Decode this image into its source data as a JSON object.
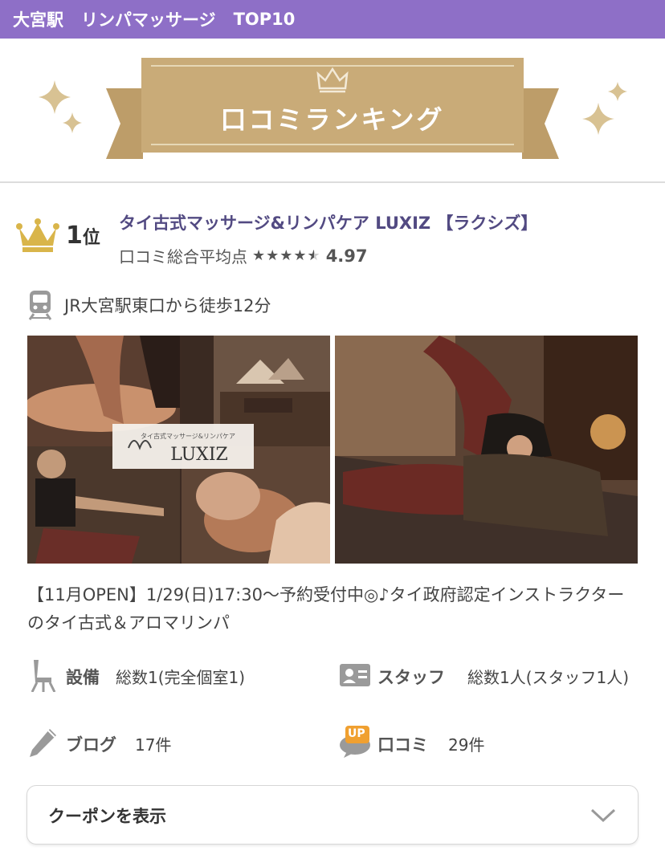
{
  "header": {
    "station": "大宮駅",
    "category": "リンパマッサージ",
    "rank_label": "TOP10"
  },
  "banner": {
    "title": "口コミランキング"
  },
  "shop": {
    "rank_number": "1",
    "rank_suffix": "位",
    "name": "タイ古式マッサージ&リンパケア LUXIZ 【ラクシズ】",
    "rating_label": "口コミ総合平均点",
    "rating_stars": 4.5,
    "rating_value": "4.97",
    "access": "JR大宮駅東口から徒歩12分",
    "photo_logo_tagline": "タイ古式マッサージ&リンパケア",
    "photo_logo_name": "LUXIZ",
    "description": "【11月OPEN】1/29(日)17:30〜予約受付中◎♪タイ政府認定インストラクターのタイ古式＆アロマリンパ",
    "facility_label": "設備",
    "facility_value": "総数1(完全個室1)",
    "staff_label": "スタッフ",
    "staff_value": "総数1人(スタッフ1人)",
    "blog_label": "ブログ",
    "blog_value": "17件",
    "review_badge": "UP",
    "review_label": "口コミ",
    "review_value": "29件"
  },
  "coupon": {
    "label": "クーポンを表示"
  },
  "colors": {
    "header_bg": "#8e6fc7",
    "ribbon_gold": "#c9ab78",
    "shop_name": "#524a82",
    "crown": "#d9b54a"
  }
}
